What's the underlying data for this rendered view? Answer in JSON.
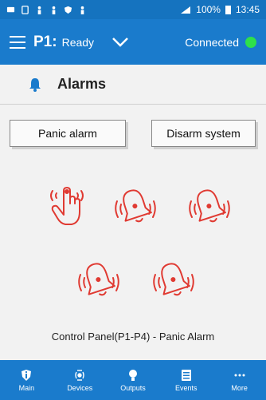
{
  "status_bar": {
    "battery": "100%",
    "time": "13:45",
    "icons": [
      "message-icon",
      "tablet-icon",
      "person-icon",
      "person-icon",
      "shield-icon",
      "person-icon"
    ]
  },
  "header": {
    "panel_id": "P1:",
    "panel_state": "Ready",
    "connection": "Connected",
    "colors": {
      "bar": "#1a7bcc",
      "connected_dot": "#2ee04a"
    }
  },
  "section": {
    "title": "Alarms",
    "icon": "bell-icon"
  },
  "buttons": {
    "panic": "Panic alarm",
    "disarm": "Disarm system"
  },
  "alarm_icons": {
    "color": "#e03a32",
    "items": [
      "panic-touch-icon",
      "ringing-bell-icon",
      "ringing-bell-icon",
      "ringing-bell-icon",
      "ringing-bell-icon"
    ]
  },
  "status_text": "Control Panel(P1-P4) - Panic Alarm",
  "bottom_nav": [
    {
      "label": "Main",
      "icon": "info-icon"
    },
    {
      "label": "Devices",
      "icon": "devices-icon"
    },
    {
      "label": "Outputs",
      "icon": "bulb-icon"
    },
    {
      "label": "Events",
      "icon": "events-icon"
    },
    {
      "label": "More",
      "icon": "more-icon"
    }
  ]
}
